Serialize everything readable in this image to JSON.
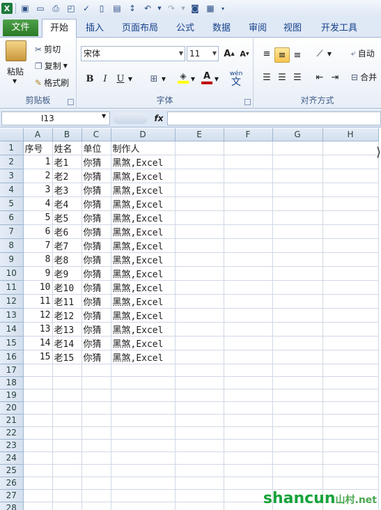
{
  "ribbon_tabs": [
    "文件",
    "开始",
    "插入",
    "页面布局",
    "公式",
    "数据",
    "审阅",
    "视图",
    "开发工具"
  ],
  "clipboard": {
    "paste": "粘贴",
    "cut": "剪切",
    "copy": "复制",
    "format_painter": "格式刷",
    "label": "剪贴板"
  },
  "font": {
    "name": "宋体",
    "size": "11",
    "bold": "B",
    "italic": "I",
    "underline": "U",
    "wen": "wén",
    "wen2": "文",
    "label": "字体",
    "font_color": "#c00000",
    "fill_color": "#ffff00"
  },
  "alignment": {
    "wrap": "自动",
    "merge": "合并",
    "label": "对齐方式"
  },
  "namebox": "I13",
  "fx": "fx",
  "columns": [
    "A",
    "B",
    "C",
    "D",
    "E",
    "F",
    "G",
    "H"
  ],
  "rows": [
    [
      "序号",
      "姓名",
      "单位",
      "制作人"
    ],
    [
      "1",
      "老1",
      "你猜",
      "黑煞,Excel"
    ],
    [
      "2",
      "老2",
      "你猜",
      "黑煞,Excel"
    ],
    [
      "3",
      "老3",
      "你猜",
      "黑煞,Excel"
    ],
    [
      "4",
      "老4",
      "你猜",
      "黑煞,Excel"
    ],
    [
      "5",
      "老5",
      "你猜",
      "黑煞,Excel"
    ],
    [
      "6",
      "老6",
      "你猜",
      "黑煞,Excel"
    ],
    [
      "7",
      "老7",
      "你猜",
      "黑煞,Excel"
    ],
    [
      "8",
      "老8",
      "你猜",
      "黑煞,Excel"
    ],
    [
      "9",
      "老9",
      "你猜",
      "黑煞,Excel"
    ],
    [
      "10",
      "老10",
      "你猜",
      "黑煞,Excel"
    ],
    [
      "11",
      "老11",
      "你猜",
      "黑煞,Excel"
    ],
    [
      "12",
      "老12",
      "你猜",
      "黑煞,Excel"
    ],
    [
      "13",
      "老13",
      "你猜",
      "黑煞,Excel"
    ],
    [
      "14",
      "老14",
      "你猜",
      "黑煞,Excel"
    ],
    [
      "15",
      "老15",
      "你猜",
      "黑煞,Excel"
    ]
  ],
  "total_rows": 29,
  "watermark": {
    "main": "shancun",
    "cn": "山村",
    "suffix": ".net"
  }
}
